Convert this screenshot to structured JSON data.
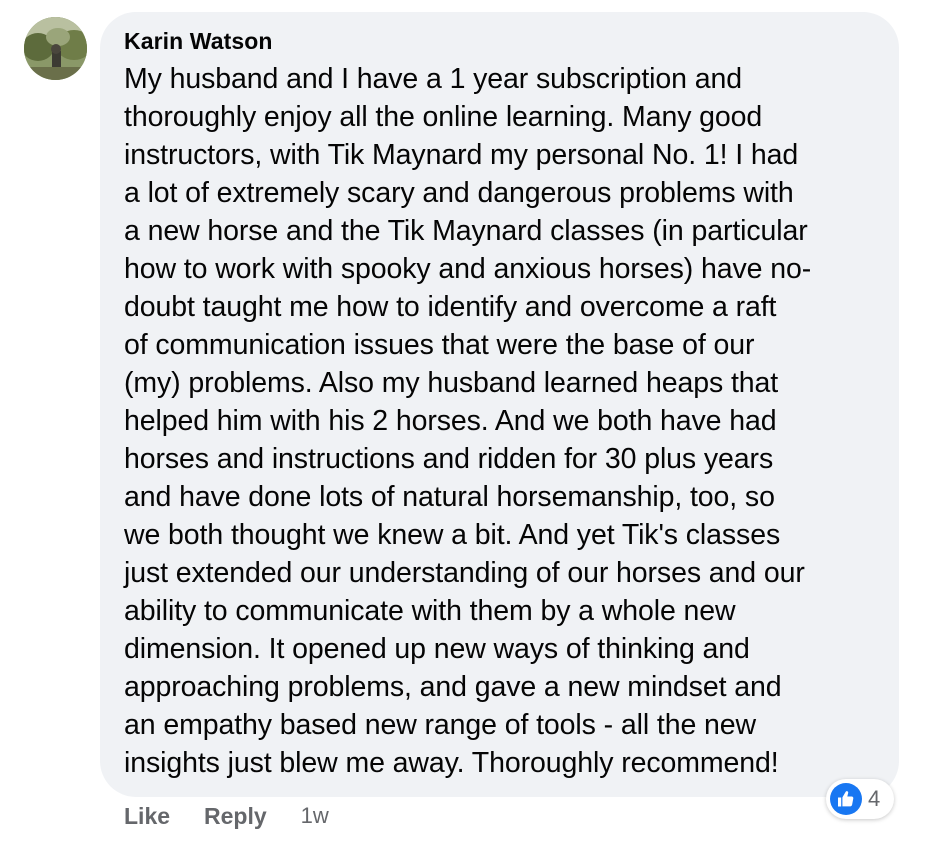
{
  "comment": {
    "author": "Karin Watson",
    "text_lines": [
      "My husband and I have a 1 year subscription and",
      "thoroughly enjoy all the online learning. Many good",
      "instructors, with Tik Maynard my personal No. 1! I had",
      "a lot of extremely scary and dangerous problems with",
      "a new horse and the Tik Maynard classes (in particular",
      "how to work with spooky and anxious horses) have no-",
      "doubt taught me how to identify and overcome a raft",
      "of communication issues that were the base of our",
      "(my) problems. Also my husband learned heaps that",
      "helped him with his 2 horses. And we both have had",
      "horses and instructions and ridden for 30 plus years",
      "and have done lots of natural horsemanship, too, so",
      "we both thought we knew a bit. And yet Tik's classes",
      "just extended our understanding of our horses and our",
      "ability to communicate with them by a whole new",
      "dimension. It opened up new ways of thinking and",
      "approaching problems, and gave a new mindset and",
      "an empathy based new range of tools - all the new",
      "insights just blew me away. Thoroughly recommend!"
    ]
  },
  "actions": {
    "like_label": "Like",
    "reply_label": "Reply",
    "timestamp": "1w"
  },
  "reactions": {
    "icon": "thumbs-up-icon",
    "count": "4"
  },
  "colors": {
    "bubble_bg": "#f0f2f5",
    "text": "#050505",
    "secondary_text": "#65676b",
    "like_blue": "#1877f2"
  }
}
